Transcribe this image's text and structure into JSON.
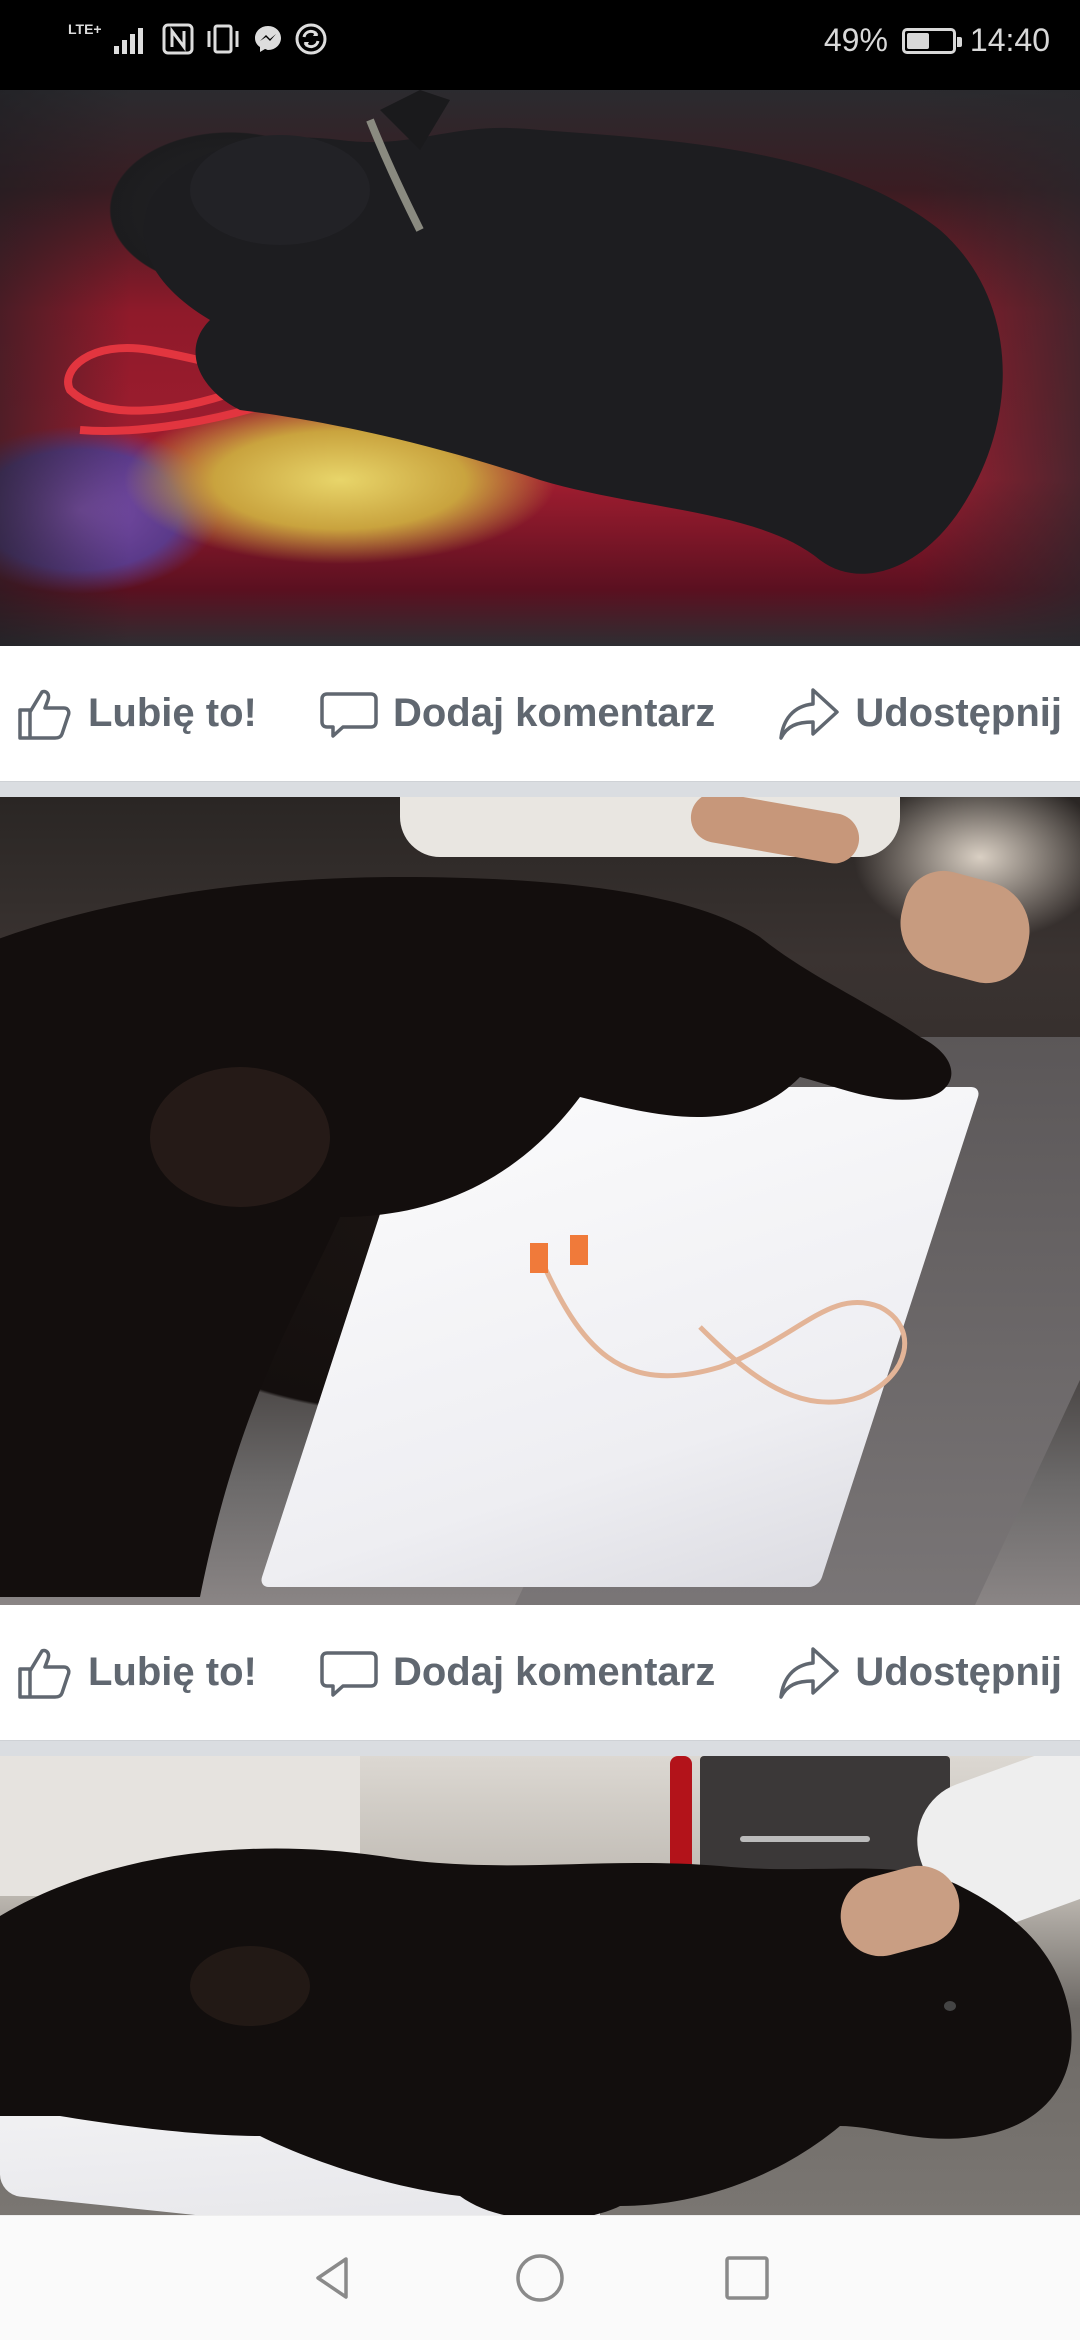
{
  "status_bar": {
    "network": "LTE+",
    "battery_percent": "49%",
    "battery_level": 0.49,
    "time": "14:40",
    "icons": [
      "signal-icon",
      "nfc-icon",
      "vibrate-icon",
      "messenger-icon",
      "sync-icon",
      "battery-icon"
    ]
  },
  "posts": [
    {
      "photo_description_icon": "dog-in-car-photo",
      "actions": {
        "like": "Lubię to!",
        "comment": "Dodaj komentarz",
        "share": "Udostępnij"
      }
    },
    {
      "photo_description_icon": "dog-on-vet-table-photo",
      "actions": {
        "like": "Lubię to!",
        "comment": "Dodaj komentarz",
        "share": "Udostępnij"
      }
    },
    {
      "photo_description_icon": "dog-with-iv-photo"
    }
  ],
  "nav_bar": {
    "icons": [
      "back-icon",
      "home-icon",
      "recents-icon"
    ]
  },
  "colors": {
    "action_text": "#606770",
    "divider": "#dadde1",
    "status_bar_bg": "#000000"
  }
}
